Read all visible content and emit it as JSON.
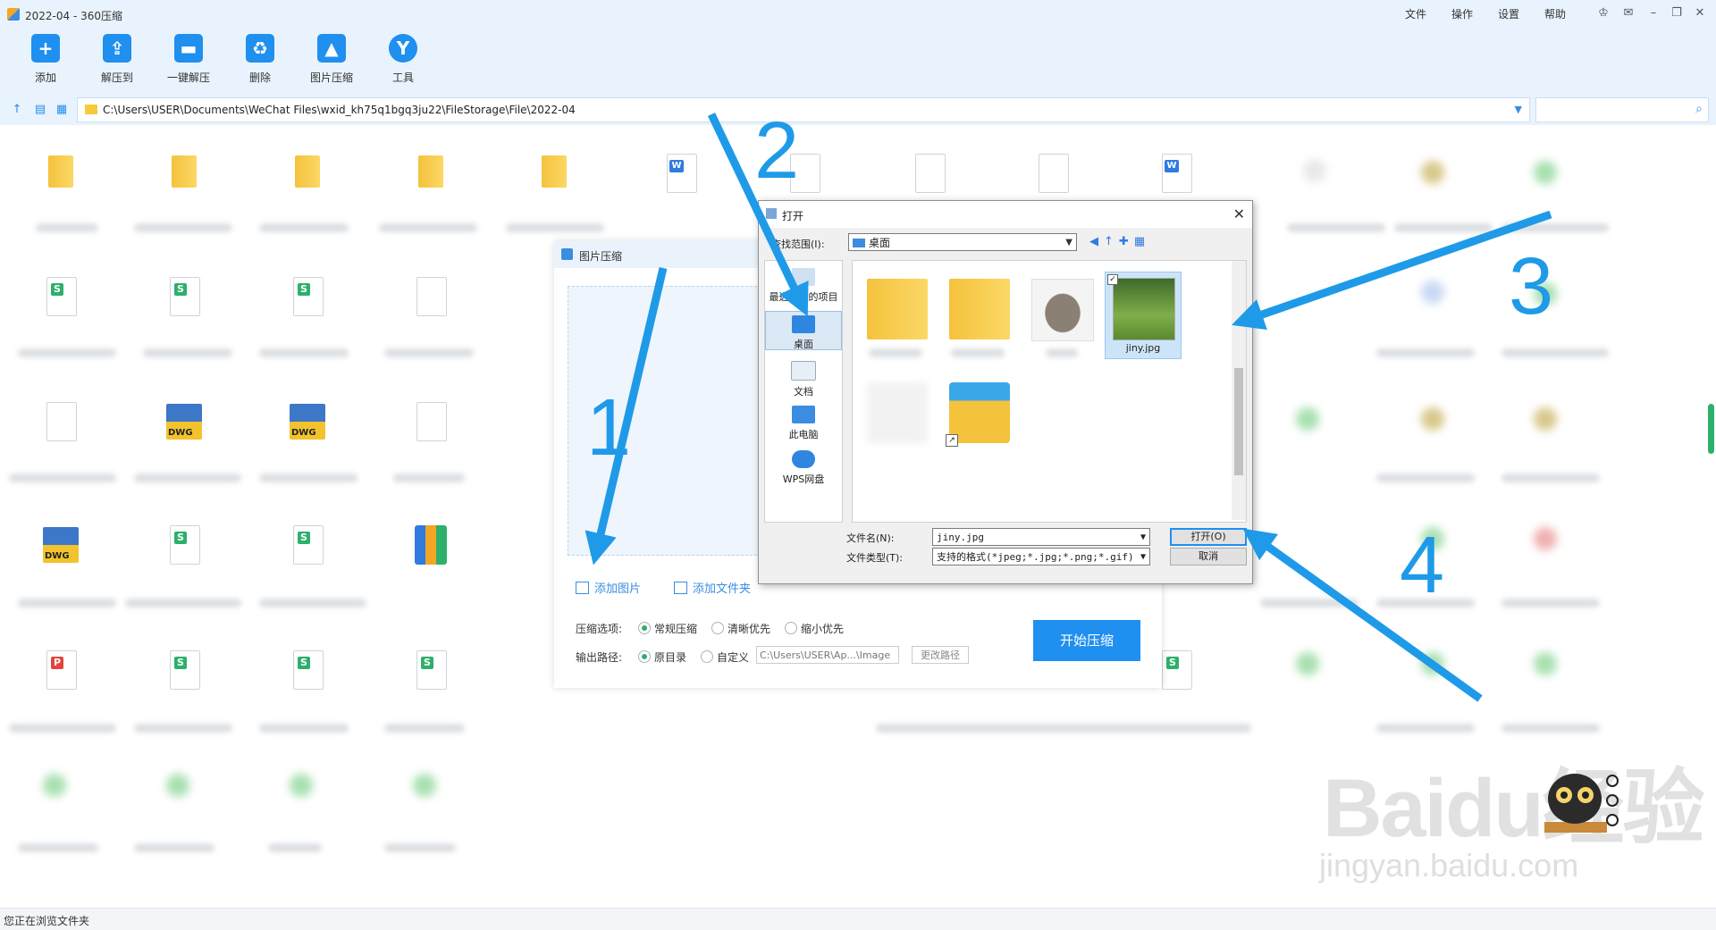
{
  "window": {
    "title": "2022-04 - 360压缩",
    "menu": [
      "文件",
      "操作",
      "设置",
      "帮助"
    ],
    "controls": [
      "skin-icon",
      "feedback-icon",
      "minimize-icon",
      "restore-icon",
      "close-icon"
    ]
  },
  "toolbar": {
    "buttons": [
      {
        "label": "添加",
        "icon": "add-icon"
      },
      {
        "label": "解压到",
        "icon": "extract-to-icon"
      },
      {
        "label": "一键解压",
        "icon": "quick-extract-icon"
      },
      {
        "label": "删除",
        "icon": "delete-icon"
      },
      {
        "label": "图片压缩",
        "icon": "image-compress-icon"
      },
      {
        "label": "工具",
        "icon": "tools-icon"
      }
    ]
  },
  "address": {
    "path": "C:\\Users\\USER\\Documents\\WeChat Files\\wxid_kh75q1bgq3ju22\\FileStorage\\File\\2022-04",
    "search_placeholder": ""
  },
  "status_bar": {
    "text": "您正在浏览文件夹"
  },
  "compress_panel": {
    "title": "图片压缩",
    "add_image": "添加图片",
    "add_folder": "添加文件夹",
    "options_label": "压缩选项:",
    "options": [
      {
        "label": "常规压缩",
        "selected": true
      },
      {
        "label": "清晰优先",
        "selected": false
      },
      {
        "label": "缩小优先",
        "selected": false
      }
    ],
    "output_label": "输出路径:",
    "outputs": [
      {
        "label": "原目录",
        "selected": true
      },
      {
        "label": "自定义",
        "selected": false
      }
    ],
    "custom_path": "C:\\Users\\USER\\Ap...\\Image",
    "change_path": "更改路径",
    "start": "开始压缩"
  },
  "open_dialog": {
    "title": "打开",
    "look_in_label": "查找范围(I):",
    "look_in_value": "桌面",
    "places": [
      {
        "label": "最近使用的项目",
        "selected": false
      },
      {
        "label": "桌面",
        "selected": true
      },
      {
        "label": "文档",
        "selected": false
      },
      {
        "label": "此电脑",
        "selected": false
      },
      {
        "label": "WPS网盘",
        "selected": false
      }
    ],
    "files": [
      {
        "name": "",
        "kind": "folder-doc"
      },
      {
        "name": "",
        "kind": "folder-pdf"
      },
      {
        "name": "",
        "kind": "rhino-image"
      },
      {
        "name": "jiny.jpg",
        "kind": "goat-image",
        "selected": true
      },
      {
        "name": "",
        "kind": "blurred"
      },
      {
        "name": "",
        "kind": "video-folder-shortcut"
      }
    ],
    "filename_label": "文件名(N):",
    "filename_value": "jiny.jpg",
    "filetype_label": "文件类型(T):",
    "filetype_value": "支持的格式(*jpeg;*.jpg;*.png;*.gif)",
    "open_button": "打开(O)",
    "cancel_button": "取消"
  },
  "annotations": {
    "steps": [
      "1",
      "2",
      "3",
      "4"
    ],
    "arrow_color": "#1f9ae8"
  },
  "watermark": {
    "brand": "Baidu经验",
    "url": "jingyan.baidu.com"
  },
  "colors": {
    "accent": "#1f8ff0",
    "chrome_bg": "#e9f3fd",
    "radio_on": "#2db06a"
  }
}
